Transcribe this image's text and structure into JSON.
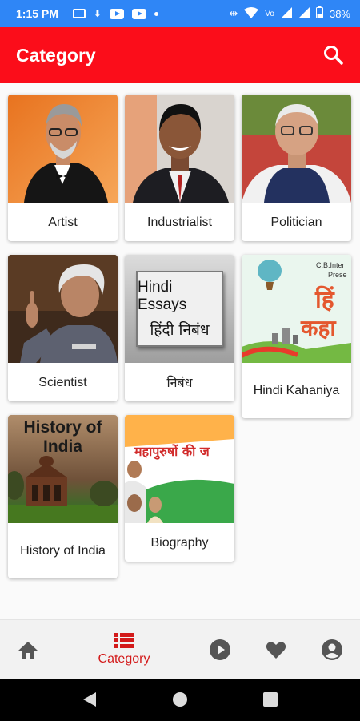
{
  "status_bar": {
    "time": "1:15 PM",
    "battery": "38%"
  },
  "app_bar": {
    "title": "Category",
    "search_icon": "search-icon"
  },
  "categories": [
    {
      "label": "Artist",
      "image": "portrait-photo"
    },
    {
      "label": "Industrialist",
      "image": "portrait-photo"
    },
    {
      "label": "Politician",
      "image": "portrait-photo"
    },
    {
      "label": "Scientist",
      "image": "portrait-photo"
    },
    {
      "label": "निबंध",
      "image": "book-cover",
      "image_text": [
        "Hindi Essays",
        "हिंदी निबंध"
      ]
    },
    {
      "label": "Hindi Kahaniya",
      "image": "illustration",
      "image_text": [
        "C.B.Inter",
        "Prese",
        "हिं",
        "कहा"
      ]
    },
    {
      "label": "History of India",
      "image": "monument-photo",
      "image_text": [
        "History of",
        "India"
      ]
    },
    {
      "label": "Biography",
      "image": "collage",
      "image_text": [
        "महापुरुषों की ज"
      ]
    }
  ],
  "bottom_nav": {
    "items": [
      {
        "icon": "home-icon"
      },
      {
        "icon": "category-icon",
        "label": "Category",
        "active": true
      },
      {
        "icon": "play-icon"
      },
      {
        "icon": "heart-icon"
      },
      {
        "icon": "account-icon"
      }
    ]
  },
  "colors": {
    "app_bar": "#fb0d1a",
    "status_bar": "#2f86f6",
    "active_nav": "#d31a1a",
    "inactive_nav": "#555555"
  }
}
